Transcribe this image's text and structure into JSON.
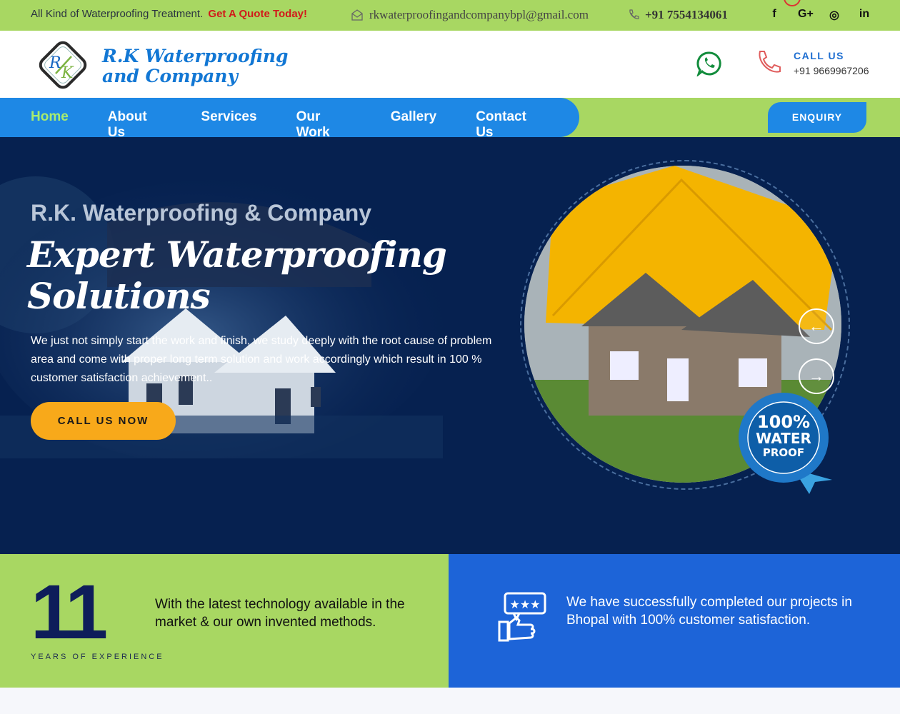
{
  "topbar": {
    "tagline": "All Kind of Waterproofing Treatment.",
    "cta": "Get A Quote Today!",
    "email": "rkwaterproofingandcompanybpl@gmail.com",
    "phone": "+91  7554134061",
    "socials": [
      "f",
      "G+",
      "◎",
      "in"
    ]
  },
  "header": {
    "logo_line1": "R.K Waterproofing",
    "logo_line2": "and Company",
    "call_label": "CALL US",
    "call_number": "+91 9669967206"
  },
  "nav": {
    "items": [
      "Home",
      "About Us",
      "Services",
      "Our Work",
      "Gallery",
      "Contact Us"
    ],
    "active": "Home",
    "enquiry": "ENQUIRY"
  },
  "hero": {
    "subtitle": "R.K. Waterproofing & Company",
    "title_line1": "Expert Waterproofing",
    "title_line2": "Solutions",
    "description": "We just not simply start the work and finish, we study deeply with the root cause of problem area and come with proper long term solution and work accordingly which result in 100 % customer satisfaction achievement..",
    "cta": "CALL US NOW",
    "badge_line1": "100%",
    "badge_line2": "WATER",
    "badge_line3": "PROOF"
  },
  "features": {
    "years": "11",
    "years_label": "YEARS OF EXPERIENCE",
    "left_text": "With the latest technology available in the market & our own invented methods.",
    "right_text": "We have successfully completed our projects in Bhopal with 100% customer satisfaction."
  },
  "colors": {
    "green": "#a8d762",
    "blue": "#1e88e5",
    "navy": "#062150",
    "orange": "#f8a91a"
  }
}
